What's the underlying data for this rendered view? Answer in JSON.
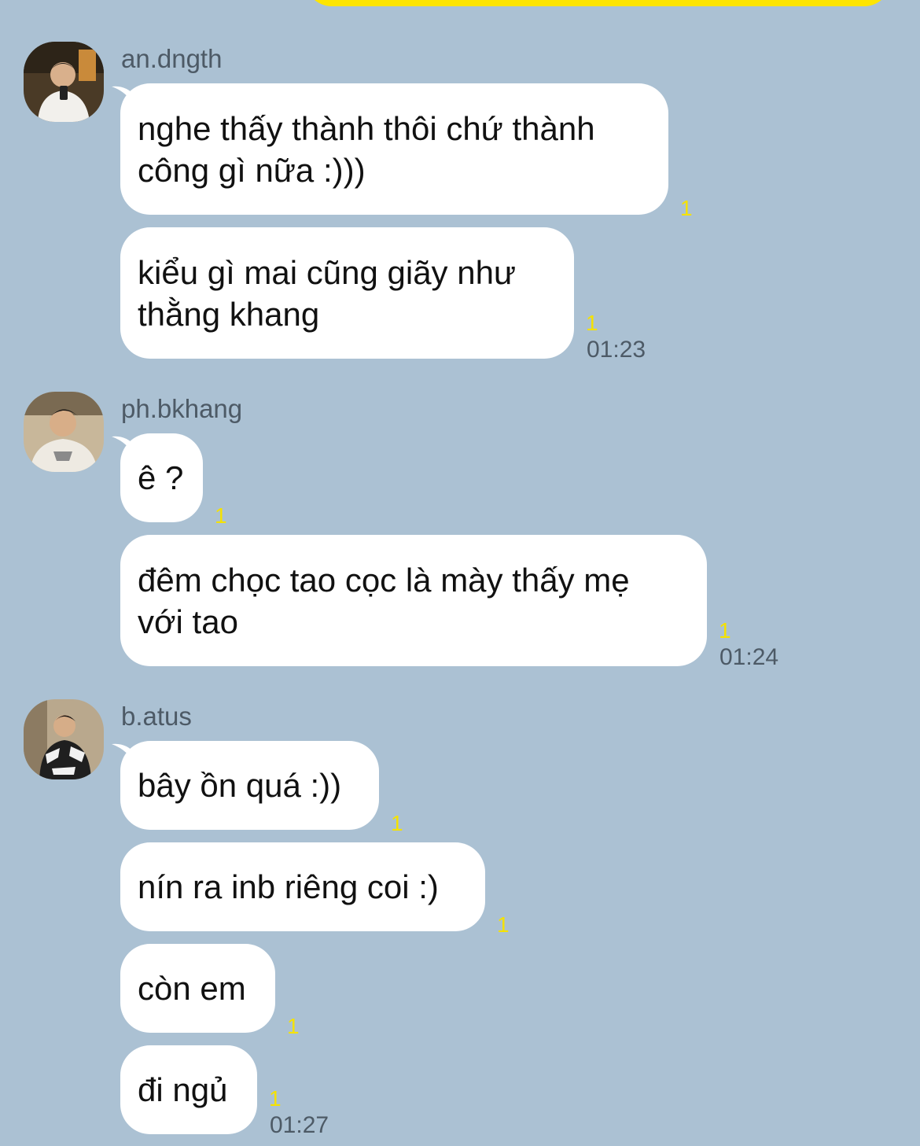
{
  "chat": {
    "groups": [
      {
        "sender": "an.dngth",
        "time": "01:23",
        "messages": [
          {
            "text": "nghe thấy thành thôi chứ thành\ncông gì nữa :)))",
            "unread": "1"
          },
          {
            "text": "kiểu gì mai cũng giãy như\nthằng khang",
            "unread": "1"
          }
        ]
      },
      {
        "sender": "ph.bkhang",
        "time": "01:24",
        "messages": [
          {
            "text": "ê ?",
            "unread": "1"
          },
          {
            "text": "đêm chọc tao cọc là mày thấy mẹ\nvới tao",
            "unread": "1"
          }
        ]
      },
      {
        "sender": "b.atus",
        "time": "01:27",
        "messages": [
          {
            "text": "bây ồn quá :))",
            "unread": "1"
          },
          {
            "text": "nín ra inb riêng coi :)",
            "unread": "1"
          },
          {
            "text": "còn em",
            "unread": "1"
          },
          {
            "text": "đi ngủ",
            "unread": "1"
          }
        ]
      }
    ]
  },
  "colors": {
    "background": "#abc1d3",
    "bubble": "#ffffff",
    "own_bubble": "#fee500",
    "unread": "#f5e200",
    "meta_text": "#4d5a66"
  }
}
